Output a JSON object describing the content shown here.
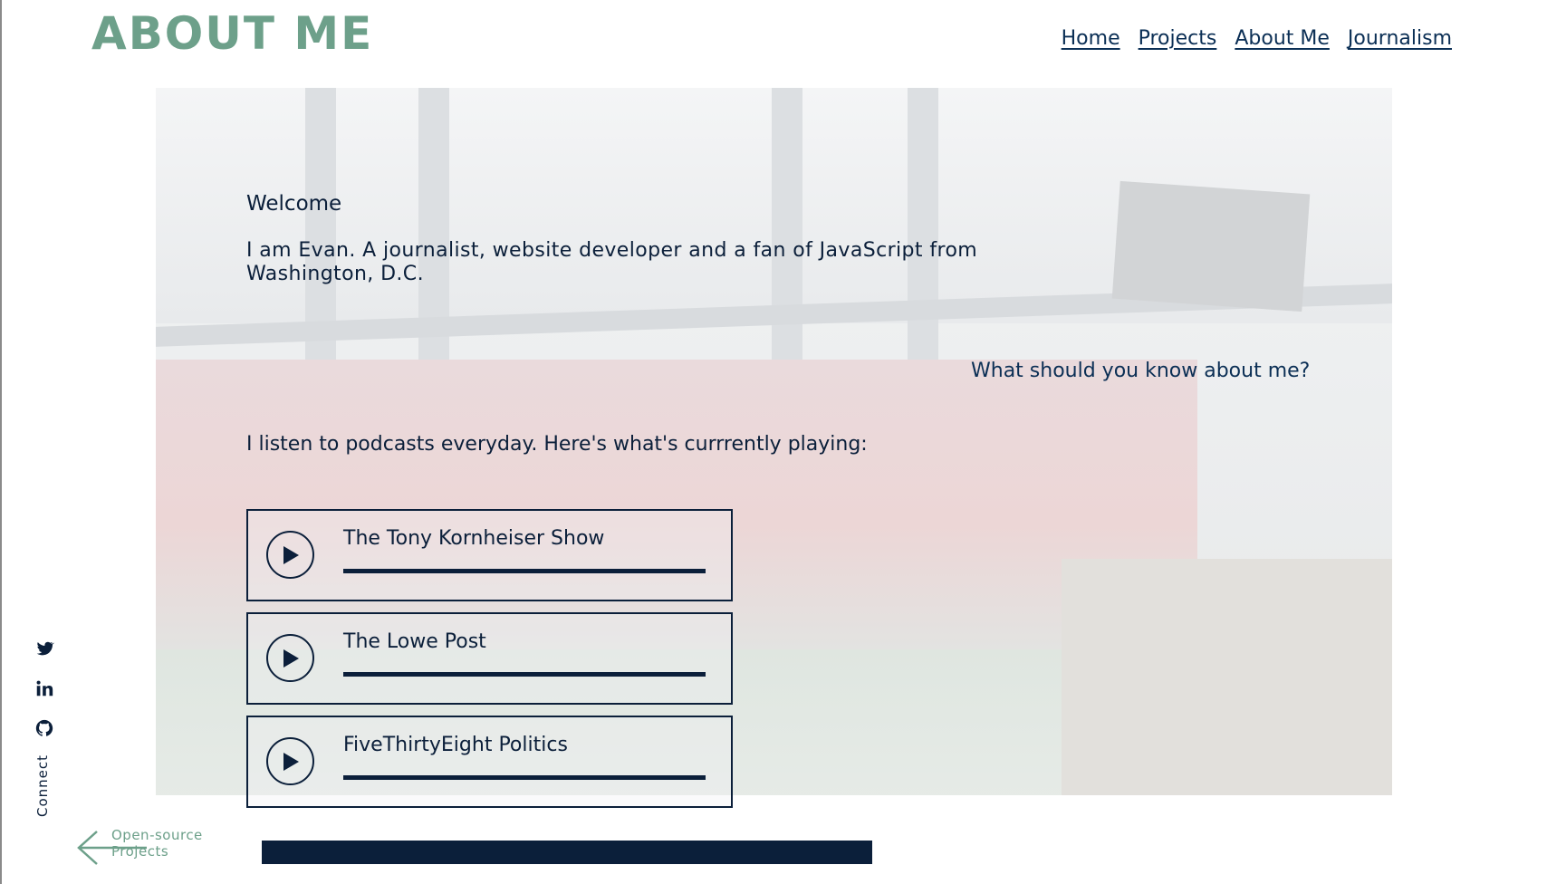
{
  "site": {
    "title": "ABOUT ME"
  },
  "nav": {
    "items": [
      {
        "label": "Home"
      },
      {
        "label": "Projects"
      },
      {
        "label": "About Me"
      },
      {
        "label": "Journalism"
      }
    ]
  },
  "main": {
    "welcome": "Welcome",
    "intro": "I am Evan. A journalist, website developer and a fan of JavaScript from Washington, D.C.",
    "question": "What should you know about me?",
    "podcast_intro": "I listen to podcasts everyday. Here's what's currrently playing:"
  },
  "podcasts": [
    {
      "title": "The Tony Kornheiser Show",
      "progress": 1.0,
      "icon": "play-icon"
    },
    {
      "title": "The Lowe Post",
      "progress": 1.0,
      "icon": "play-icon"
    },
    {
      "title": "FiveThirtyEight Politics",
      "progress": 1.0,
      "icon": "play-icon"
    }
  ],
  "social": {
    "icons": [
      "twitter-icon",
      "linkedin-icon",
      "github-icon"
    ],
    "label": "Connect"
  },
  "footer": {
    "prev_label": "Open-source Projects",
    "prev_icon": "arrow-left-icon"
  },
  "colors": {
    "accent": "#6da08a",
    "navy": "#0b1f3a",
    "nav_link": "#0b2f55"
  }
}
